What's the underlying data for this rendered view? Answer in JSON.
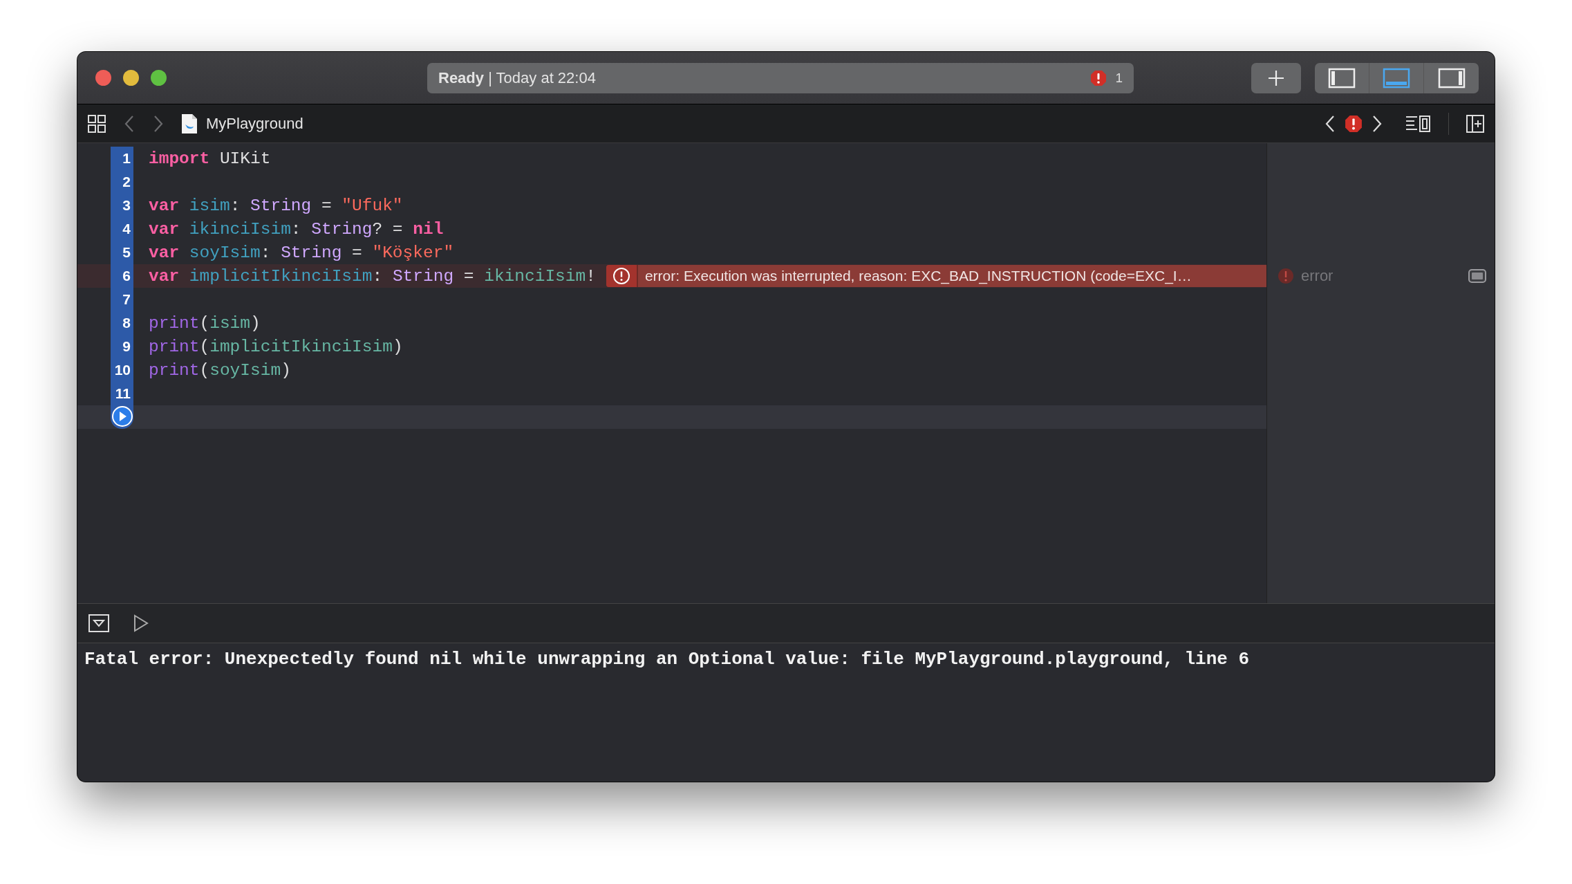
{
  "window": {
    "activity": {
      "status": "**Ready** | Today at 22:04",
      "issue_count": "1"
    },
    "layout_toggles": [
      {
        "selected": false
      },
      {
        "selected": true
      },
      {
        "selected": false
      }
    ]
  },
  "jump_bar": {
    "back": {
      "disabled": true
    },
    "forward": {
      "disabled": true
    },
    "file": "MyPlayground"
  },
  "editor": {
    "lines": [
      {
        "number": "1",
        "executed": true,
        "tokens": [
          {
            "kind": "keyword",
            "text": "import"
          },
          {
            "kind": "plain",
            "text": " UIKit"
          }
        ]
      },
      {
        "number": "2",
        "executed": true
      },
      {
        "number": "3",
        "executed": true,
        "tokens": [
          {
            "kind": "keyword",
            "text": "var "
          },
          {
            "kind": "decl",
            "text": "isim"
          },
          {
            "kind": "plain",
            "text": ": "
          },
          {
            "kind": "type",
            "text": "String"
          },
          {
            "kind": "plain",
            "text": " = "
          },
          {
            "kind": "string",
            "text": "\"Ufuk\""
          }
        ]
      },
      {
        "number": "4",
        "executed": true,
        "tokens": [
          {
            "kind": "keyword",
            "text": "var "
          },
          {
            "kind": "decl",
            "text": "ikinciIsim"
          },
          {
            "kind": "plain",
            "text": ": "
          },
          {
            "kind": "type",
            "text": "String"
          },
          {
            "kind": "plain",
            "text": "? = "
          },
          {
            "kind": "keyword",
            "text": "nil"
          }
        ]
      },
      {
        "number": "5",
        "executed": true,
        "tokens": [
          {
            "kind": "keyword",
            "text": "var "
          },
          {
            "kind": "decl",
            "text": "soyIsim"
          },
          {
            "kind": "plain",
            "text": ": "
          },
          {
            "kind": "type",
            "text": "String"
          },
          {
            "kind": "plain",
            "text": " = "
          },
          {
            "kind": "string",
            "text": "\"Köşker\""
          }
        ]
      },
      {
        "number": "6",
        "executed": true,
        "tokens": [
          {
            "kind": "keyword",
            "text": "var "
          },
          {
            "kind": "decl",
            "text": "implicitIkinciIsim"
          },
          {
            "kind": "plain",
            "text": ": "
          },
          {
            "kind": "type",
            "text": "String"
          },
          {
            "kind": "plain",
            "text": " = "
          },
          {
            "kind": "ref",
            "text": "ikinciIsim"
          },
          {
            "kind": "plain",
            "text": "!"
          }
        ],
        "error": {
          "message": "error: Execution was interrupted, reason: EXC_BAD_INSTRUCTION (code=EXC_I…"
        },
        "result": "error"
      },
      {
        "number": "7",
        "executed": true
      },
      {
        "number": "8",
        "executed": true,
        "tokens": [
          {
            "kind": "func",
            "text": "print"
          },
          {
            "kind": "plain",
            "text": "("
          },
          {
            "kind": "ref",
            "text": "isim"
          },
          {
            "kind": "plain",
            "text": ")"
          }
        ]
      },
      {
        "number": "9",
        "executed": true,
        "tokens": [
          {
            "kind": "func",
            "text": "print"
          },
          {
            "kind": "plain",
            "text": "("
          },
          {
            "kind": "ref",
            "text": "implicitIkinciIsim"
          },
          {
            "kind": "plain",
            "text": ")"
          }
        ]
      },
      {
        "number": "10",
        "executed": true,
        "tokens": [
          {
            "kind": "func",
            "text": "print"
          },
          {
            "kind": "plain",
            "text": "("
          },
          {
            "kind": "ref",
            "text": "soyIsim"
          },
          {
            "kind": "plain",
            "text": ")"
          }
        ]
      },
      {
        "number": "11",
        "executed": true
      }
    ],
    "run_row": {
      "current": true
    }
  },
  "console": {
    "output": "Fatal error: Unexpectedly found nil while unwrapping an Optional value: file MyPlayground.playground, line 6"
  }
}
